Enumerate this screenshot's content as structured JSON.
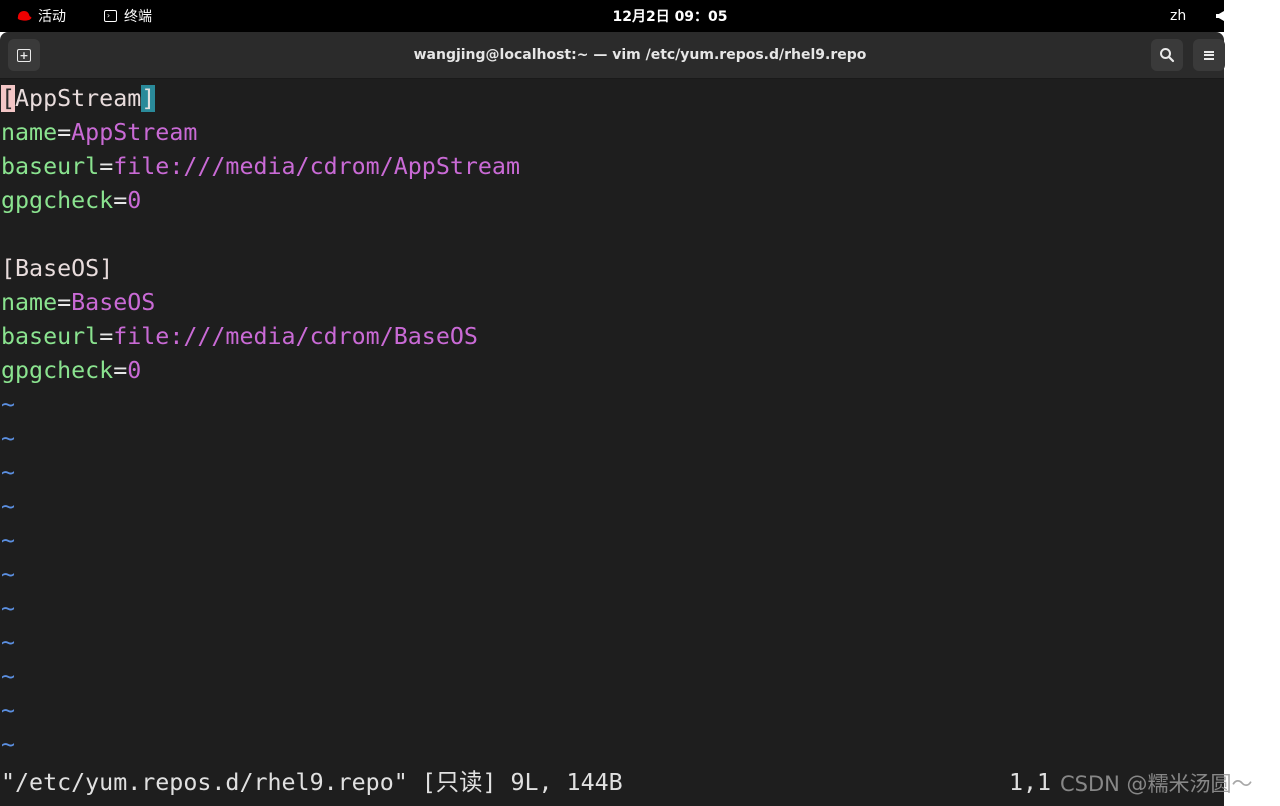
{
  "topbar": {
    "activities": "活动",
    "app": "终端",
    "clock": "12月2日 09：05",
    "lang": "zh"
  },
  "window": {
    "title": "wangjing@localhost:~ — vim /etc/yum.repos.d/rhel9.repo"
  },
  "editor": {
    "section1": {
      "open": "[",
      "name": "AppStream",
      "close": "]"
    },
    "line2": {
      "key": "name",
      "eq": "=",
      "value": "AppStream"
    },
    "line3": {
      "key": "baseurl",
      "eq": "=",
      "value": "file:///media/cdrom/AppStream"
    },
    "line4": {
      "key": "gpgcheck",
      "eq": "=",
      "value": "0"
    },
    "section2": "[BaseOS]",
    "line7": {
      "key": "name",
      "eq": "=",
      "value": "BaseOS"
    },
    "line8": {
      "key": "baseurl",
      "eq": "=",
      "value": "file:///media/cdrom/BaseOS"
    },
    "line9": {
      "key": "gpgcheck",
      "eq": "=",
      "value": "0"
    },
    "tilde": "~",
    "status_message": "\"/etc/yum.repos.d/rhel9.repo\" [只读] 9L, 144B",
    "cursor_position": "1,1"
  },
  "watermark": "CSDN @糯米汤圆～"
}
